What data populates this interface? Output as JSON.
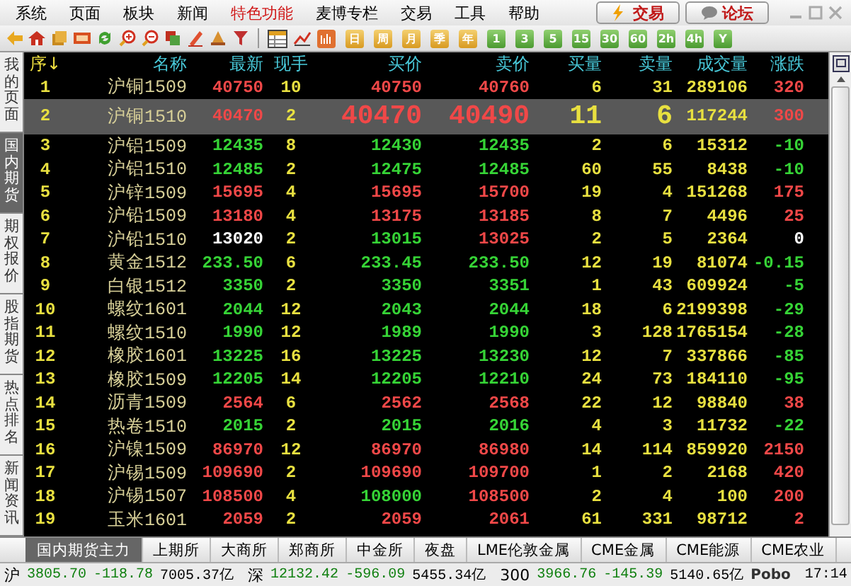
{
  "menu": [
    {
      "label": "系统",
      "highlighted": false
    },
    {
      "label": "页面",
      "highlighted": false
    },
    {
      "label": "板块",
      "highlighted": false
    },
    {
      "label": "新闻",
      "highlighted": false
    },
    {
      "label": "特色功能",
      "highlighted": true
    },
    {
      "label": "麦博专栏",
      "highlighted": false
    },
    {
      "label": "交易",
      "highlighted": false
    },
    {
      "label": "工具",
      "highlighted": false
    },
    {
      "label": "帮助",
      "highlighted": false
    }
  ],
  "top_buttons": [
    {
      "kind": "trade",
      "label": "交易"
    },
    {
      "kind": "forum",
      "label": "论坛"
    }
  ],
  "period_buttons": [
    {
      "kind": "period",
      "label": "日"
    },
    {
      "kind": "period",
      "label": "周"
    },
    {
      "kind": "period",
      "label": "月"
    },
    {
      "kind": "period",
      "label": "季"
    },
    {
      "kind": "period",
      "label": "年"
    },
    {
      "kind": "minute",
      "label": "1"
    },
    {
      "kind": "minute",
      "label": "3"
    },
    {
      "kind": "minute",
      "label": "5"
    },
    {
      "kind": "minute",
      "label": "15"
    },
    {
      "kind": "minute",
      "label": "30"
    },
    {
      "kind": "minute",
      "label": "60"
    },
    {
      "kind": "minute",
      "label": "2h"
    },
    {
      "kind": "minute",
      "label": "4h"
    },
    {
      "kind": "minute",
      "label": "Y"
    }
  ],
  "side_tabs": [
    {
      "label": "我的页面",
      "selected": false
    },
    {
      "label": "国内期货",
      "selected": true
    },
    {
      "label": "期权报价",
      "selected": false
    },
    {
      "label": "股指期货",
      "selected": false
    },
    {
      "label": "热点排名",
      "selected": false
    },
    {
      "label": "新闻资讯",
      "selected": false
    }
  ],
  "table": {
    "columns": [
      "序↓",
      "名称",
      "最新",
      "现手",
      "买价",
      "卖价",
      "买量",
      "卖量",
      "成交量",
      "涨跌"
    ],
    "rows": [
      {
        "no": "1",
        "name": "沪铜1509",
        "last": {
          "v": "40750",
          "color": "#f04848"
        },
        "hand": "10",
        "bid": {
          "v": "40750",
          "color": "#f04848"
        },
        "ask": {
          "v": "40760",
          "color": "#f04848"
        },
        "bid_vol": "6",
        "ask_vol": "31",
        "volume": "289106",
        "change": {
          "v": "320",
          "color": "#f04848"
        },
        "selected": false
      },
      {
        "no": "2",
        "name": "沪铜1510",
        "last": {
          "v": "40470",
          "color": "#f04848"
        },
        "hand": "2",
        "bid": {
          "v": "40470",
          "color": "#f04848"
        },
        "ask": {
          "v": "40490",
          "color": "#f04848"
        },
        "bid_vol": "11",
        "ask_vol": "6",
        "volume": "117244",
        "change": {
          "v": "300",
          "color": "#f04848"
        },
        "selected": true
      },
      {
        "no": "3",
        "name": "沪铝1509",
        "last": {
          "v": "12435",
          "color": "#36d436"
        },
        "hand": "8",
        "bid": {
          "v": "12430",
          "color": "#36d436"
        },
        "ask": {
          "v": "12435",
          "color": "#36d436"
        },
        "bid_vol": "2",
        "ask_vol": "6",
        "volume": "15312",
        "change": {
          "v": "-10",
          "color": "#36d436"
        },
        "selected": false
      },
      {
        "no": "4",
        "name": "沪铝1510",
        "last": {
          "v": "12485",
          "color": "#36d436"
        },
        "hand": "2",
        "bid": {
          "v": "12475",
          "color": "#36d436"
        },
        "ask": {
          "v": "12485",
          "color": "#36d436"
        },
        "bid_vol": "60",
        "ask_vol": "55",
        "volume": "8438",
        "change": {
          "v": "-10",
          "color": "#36d436"
        },
        "selected": false
      },
      {
        "no": "5",
        "name": "沪锌1509",
        "last": {
          "v": "15695",
          "color": "#f04848"
        },
        "hand": "4",
        "bid": {
          "v": "15695",
          "color": "#f04848"
        },
        "ask": {
          "v": "15700",
          "color": "#f04848"
        },
        "bid_vol": "19",
        "ask_vol": "4",
        "volume": "151268",
        "change": {
          "v": "175",
          "color": "#f04848"
        },
        "selected": false
      },
      {
        "no": "6",
        "name": "沪铅1509",
        "last": {
          "v": "13180",
          "color": "#f04848"
        },
        "hand": "4",
        "bid": {
          "v": "13175",
          "color": "#f04848"
        },
        "ask": {
          "v": "13185",
          "color": "#f04848"
        },
        "bid_vol": "8",
        "ask_vol": "7",
        "volume": "4496",
        "change": {
          "v": "25",
          "color": "#f04848"
        },
        "selected": false
      },
      {
        "no": "7",
        "name": "沪铅1510",
        "last": {
          "v": "13020",
          "color": "#ffffff"
        },
        "hand": "2",
        "bid": {
          "v": "13015",
          "color": "#36d436"
        },
        "ask": {
          "v": "13025",
          "color": "#f04848"
        },
        "bid_vol": "2",
        "ask_vol": "5",
        "volume": "2364",
        "change": {
          "v": "0",
          "color": "#ffffff"
        },
        "selected": false
      },
      {
        "no": "8",
        "name": "黄金1512",
        "last": {
          "v": "233.50",
          "color": "#36d436"
        },
        "hand": "6",
        "bid": {
          "v": "233.45",
          "color": "#36d436"
        },
        "ask": {
          "v": "233.50",
          "color": "#36d436"
        },
        "bid_vol": "12",
        "ask_vol": "19",
        "volume": "81074",
        "change": {
          "v": "-0.15",
          "color": "#36d436"
        },
        "selected": false
      },
      {
        "no": "9",
        "name": "白银1512",
        "last": {
          "v": "3350",
          "color": "#36d436"
        },
        "hand": "2",
        "bid": {
          "v": "3350",
          "color": "#36d436"
        },
        "ask": {
          "v": "3351",
          "color": "#36d436"
        },
        "bid_vol": "1",
        "ask_vol": "43",
        "volume": "609924",
        "change": {
          "v": "-5",
          "color": "#36d436"
        },
        "selected": false
      },
      {
        "no": "10",
        "name": "螺纹1601",
        "last": {
          "v": "2044",
          "color": "#36d436"
        },
        "hand": "12",
        "bid": {
          "v": "2043",
          "color": "#36d436"
        },
        "ask": {
          "v": "2044",
          "color": "#36d436"
        },
        "bid_vol": "18",
        "ask_vol": "6",
        "volume": "2199398",
        "change": {
          "v": "-29",
          "color": "#36d436"
        },
        "selected": false
      },
      {
        "no": "11",
        "name": "螺纹1510",
        "last": {
          "v": "1990",
          "color": "#36d436"
        },
        "hand": "12",
        "bid": {
          "v": "1989",
          "color": "#36d436"
        },
        "ask": {
          "v": "1990",
          "color": "#36d436"
        },
        "bid_vol": "3",
        "ask_vol": "128",
        "volume": "1765154",
        "change": {
          "v": "-28",
          "color": "#36d436"
        },
        "selected": false
      },
      {
        "no": "12",
        "name": "橡胶1601",
        "last": {
          "v": "13225",
          "color": "#36d436"
        },
        "hand": "16",
        "bid": {
          "v": "13225",
          "color": "#36d436"
        },
        "ask": {
          "v": "13230",
          "color": "#36d436"
        },
        "bid_vol": "12",
        "ask_vol": "7",
        "volume": "337866",
        "change": {
          "v": "-85",
          "color": "#36d436"
        },
        "selected": false
      },
      {
        "no": "13",
        "name": "橡胶1509",
        "last": {
          "v": "12205",
          "color": "#36d436"
        },
        "hand": "14",
        "bid": {
          "v": "12205",
          "color": "#36d436"
        },
        "ask": {
          "v": "12210",
          "color": "#36d436"
        },
        "bid_vol": "24",
        "ask_vol": "73",
        "volume": "184110",
        "change": {
          "v": "-95",
          "color": "#36d436"
        },
        "selected": false
      },
      {
        "no": "14",
        "name": "沥青1509",
        "last": {
          "v": "2564",
          "color": "#f04848"
        },
        "hand": "6",
        "bid": {
          "v": "2562",
          "color": "#f04848"
        },
        "ask": {
          "v": "2568",
          "color": "#f04848"
        },
        "bid_vol": "22",
        "ask_vol": "12",
        "volume": "98840",
        "change": {
          "v": "38",
          "color": "#f04848"
        },
        "selected": false
      },
      {
        "no": "15",
        "name": "热卷1510",
        "last": {
          "v": "2015",
          "color": "#36d436"
        },
        "hand": "2",
        "bid": {
          "v": "2015",
          "color": "#36d436"
        },
        "ask": {
          "v": "2016",
          "color": "#36d436"
        },
        "bid_vol": "4",
        "ask_vol": "3",
        "volume": "11732",
        "change": {
          "v": "-22",
          "color": "#36d436"
        },
        "selected": false
      },
      {
        "no": "16",
        "name": "沪镍1509",
        "last": {
          "v": "86970",
          "color": "#f04848"
        },
        "hand": "12",
        "bid": {
          "v": "86970",
          "color": "#f04848"
        },
        "ask": {
          "v": "86980",
          "color": "#f04848"
        },
        "bid_vol": "14",
        "ask_vol": "114",
        "volume": "859920",
        "change": {
          "v": "2150",
          "color": "#f04848"
        },
        "selected": false
      },
      {
        "no": "17",
        "name": "沪锡1509",
        "last": {
          "v": "109690",
          "color": "#f04848"
        },
        "hand": "2",
        "bid": {
          "v": "109690",
          "color": "#f04848"
        },
        "ask": {
          "v": "109700",
          "color": "#f04848"
        },
        "bid_vol": "1",
        "ask_vol": "2",
        "volume": "2168",
        "change": {
          "v": "420",
          "color": "#f04848"
        },
        "selected": false
      },
      {
        "no": "18",
        "name": "沪锡1507",
        "last": {
          "v": "108500",
          "color": "#f04848"
        },
        "hand": "4",
        "bid": {
          "v": "108000",
          "color": "#36d436"
        },
        "ask": {
          "v": "108500",
          "color": "#f04848"
        },
        "bid_vol": "2",
        "ask_vol": "4",
        "volume": "100",
        "change": {
          "v": "200",
          "color": "#f04848"
        },
        "selected": false
      },
      {
        "no": "19",
        "name": "玉米1601",
        "last": {
          "v": "2059",
          "color": "#f04848"
        },
        "hand": "2",
        "bid": {
          "v": "2059",
          "color": "#f04848"
        },
        "ask": {
          "v": "2061",
          "color": "#f04848"
        },
        "bid_vol": "61",
        "ask_vol": "331",
        "volume": "98712",
        "change": {
          "v": "2",
          "color": "#f04848"
        },
        "selected": false
      }
    ]
  },
  "market_tabs": [
    {
      "label": "国内期货主力",
      "selected": true
    },
    {
      "label": "上期所",
      "selected": false
    },
    {
      "label": "大商所",
      "selected": false
    },
    {
      "label": "郑商所",
      "selected": false
    },
    {
      "label": "中金所",
      "selected": false
    },
    {
      "label": "夜盘",
      "selected": false
    },
    {
      "label": "LME伦敦金属",
      "selected": false
    },
    {
      "label": "CME金属",
      "selected": false
    },
    {
      "label": "CME能源",
      "selected": false
    },
    {
      "label": "CME农业",
      "selected": false
    }
  ],
  "status_bar": {
    "indices": [
      {
        "label": "沪",
        "value": "3805.70",
        "change": "-118.78",
        "amount": "7005.37亿",
        "color": "#108010"
      },
      {
        "label": "深",
        "value": "12132.42",
        "change": "-596.09",
        "amount": "5455.34亿",
        "color": "#108010"
      },
      {
        "label": "300",
        "value": "3966.76",
        "change": "-145.39",
        "amount": "5140.65亿",
        "color": "#108010"
      }
    ],
    "brand": "Pobo",
    "time": "17:14"
  }
}
